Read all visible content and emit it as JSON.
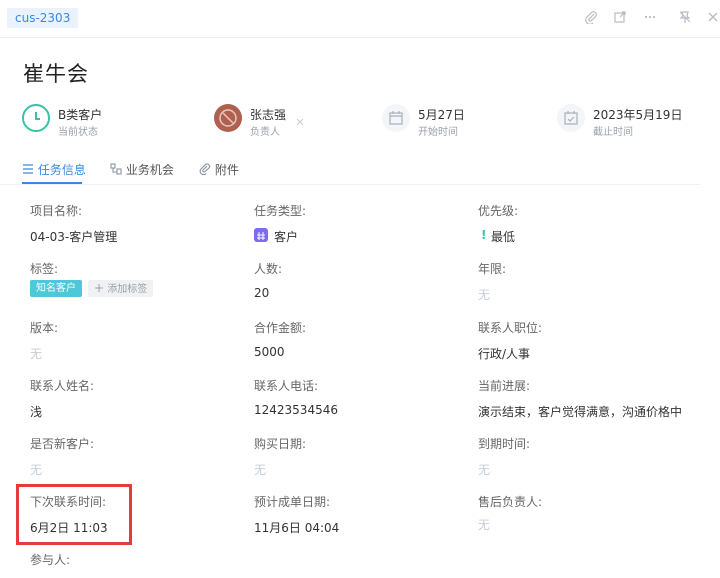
{
  "header": {
    "task_id": "cus-2303"
  },
  "title": "崔牛会",
  "stats": [
    {
      "value": "B类客户",
      "label": "当前状态",
      "icon": "clock-icon",
      "color": "#3cc0a4"
    },
    {
      "value": "张志强",
      "label": "负责人",
      "icon": "avatar"
    },
    {
      "value": "5月27日",
      "label": "开始时间",
      "icon": "calendar-icon"
    },
    {
      "value": "2023年5月19日",
      "label": "截止时间",
      "icon": "calendar-check-icon"
    }
  ],
  "tabs": [
    {
      "label": "任务信息",
      "icon": "list-icon",
      "active": true
    },
    {
      "label": "业务机会",
      "icon": "opportunity-icon"
    },
    {
      "label": "附件",
      "icon": "paperclip-icon"
    }
  ],
  "fields": {
    "project_name": {
      "label": "项目名称:",
      "value": "04-03-客户管理"
    },
    "task_type": {
      "label": "任务类型:",
      "value": "客户"
    },
    "priority": {
      "label": "优先级:",
      "value": "最低"
    },
    "tags": {
      "label": "标签:",
      "tag": "知名客户",
      "add_label": "添加标签"
    },
    "people_count": {
      "label": "人数:",
      "value": "20"
    },
    "years": {
      "label": "年限:",
      "value": "无"
    },
    "version": {
      "label": "版本:",
      "value": "无"
    },
    "amount": {
      "label": "合作金额:",
      "value": "5000"
    },
    "contact_position": {
      "label": "联系人职位:",
      "value": "行政/人事"
    },
    "contact_name": {
      "label": "联系人姓名:",
      "value": "浅"
    },
    "contact_phone": {
      "label": "联系人电话:",
      "value": "12423534546"
    },
    "progress": {
      "label": "当前进展:",
      "value": "演示结束，客户觉得满意，沟通价格中"
    },
    "is_new_customer": {
      "label": "是否新客户:",
      "value": "无"
    },
    "purchase_date": {
      "label": "购买日期:",
      "value": "无"
    },
    "due_time": {
      "label": "到期时间:",
      "value": "无"
    },
    "next_contact": {
      "label": "下次联系时间:",
      "value": "6月2日 11:03"
    },
    "expected_close": {
      "label": "预计成单日期:",
      "value": "11月6日 04:04"
    },
    "after_sales": {
      "label": "售后负责人:",
      "value": "无"
    },
    "participants": {
      "label": "参与人:"
    }
  },
  "colors": {
    "accent": "#3e87e0",
    "tag": "#4ec7d8",
    "highlight": "#e43b3b",
    "type_badge": "#7b6cf0"
  }
}
